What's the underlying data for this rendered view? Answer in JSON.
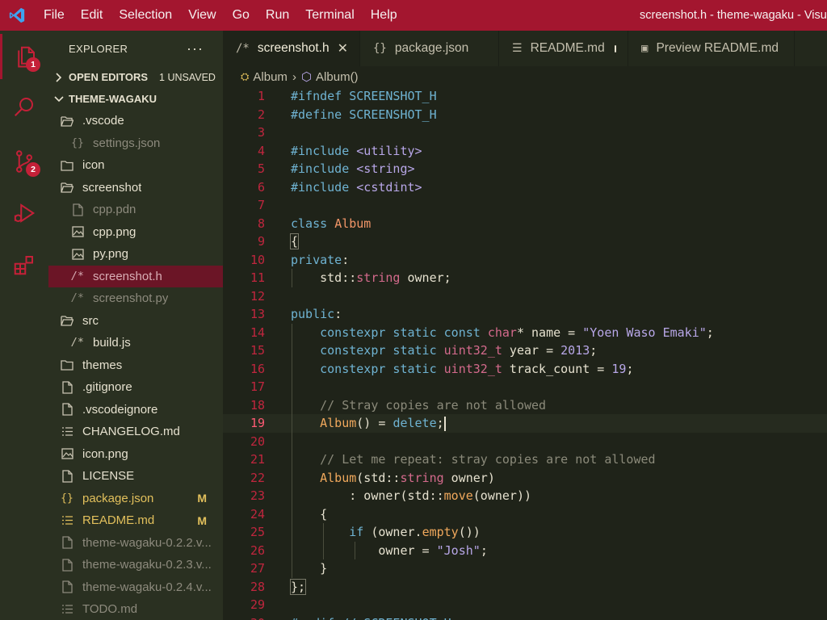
{
  "titlebar": {
    "menu": [
      "File",
      "Edit",
      "Selection",
      "View",
      "Go",
      "Run",
      "Terminal",
      "Help"
    ],
    "window_title": "screenshot.h - theme-wagaku - Visu"
  },
  "activity": {
    "explorer_badge": "1",
    "scm_badge": "2"
  },
  "sidebar": {
    "title": "EXPLORER",
    "more": "···",
    "open_editors": "OPEN EDITORS",
    "unsaved": "1 UNSAVED",
    "project": "THEME-WAGAKU",
    "items": [
      {
        "label": ".vscode",
        "icon": "folder-open",
        "indent": 15,
        "state": ""
      },
      {
        "label": "settings.json",
        "icon": "braces",
        "indent": 28,
        "state": "dim"
      },
      {
        "label": "icon",
        "icon": "folder",
        "indent": 15,
        "state": ""
      },
      {
        "label": "screenshot",
        "icon": "folder-open",
        "indent": 15,
        "state": ""
      },
      {
        "label": "cpp.pdn",
        "icon": "file",
        "indent": 28,
        "state": "dim"
      },
      {
        "label": "cpp.png",
        "icon": "image",
        "indent": 28,
        "state": ""
      },
      {
        "label": "py.png",
        "icon": "image",
        "indent": 28,
        "state": ""
      },
      {
        "label": "screenshot.h",
        "icon": "comment",
        "indent": 28,
        "state": "selected"
      },
      {
        "label": "screenshot.py",
        "icon": "comment",
        "indent": 28,
        "state": "dim"
      },
      {
        "label": "src",
        "icon": "folder-open",
        "indent": 15,
        "state": ""
      },
      {
        "label": "build.js",
        "icon": "comment",
        "indent": 28,
        "state": ""
      },
      {
        "label": "themes",
        "icon": "folder",
        "indent": 15,
        "state": ""
      },
      {
        "label": ".gitignore",
        "icon": "file",
        "indent": 15,
        "state": ""
      },
      {
        "label": ".vscodeignore",
        "icon": "file",
        "indent": 15,
        "state": ""
      },
      {
        "label": "CHANGELOG.md",
        "icon": "lines",
        "indent": 15,
        "state": ""
      },
      {
        "label": "icon.png",
        "icon": "image",
        "indent": 15,
        "state": ""
      },
      {
        "label": "LICENSE",
        "icon": "file",
        "indent": 15,
        "state": ""
      },
      {
        "label": "package.json",
        "icon": "braces",
        "indent": 15,
        "state": "mod",
        "mark": "M"
      },
      {
        "label": "README.md",
        "icon": "lines",
        "indent": 15,
        "state": "mod",
        "mark": "M"
      },
      {
        "label": "theme-wagaku-0.2.2.v...",
        "icon": "file",
        "indent": 15,
        "state": "dim"
      },
      {
        "label": "theme-wagaku-0.2.3.v...",
        "icon": "file",
        "indent": 15,
        "state": "dim"
      },
      {
        "label": "theme-wagaku-0.2.4.v...",
        "icon": "file",
        "indent": 15,
        "state": "dim"
      },
      {
        "label": "TODO.md",
        "icon": "lines",
        "indent": 15,
        "state": "dim"
      }
    ]
  },
  "tabs": [
    {
      "icon": "/*",
      "label": "screenshot.h",
      "active": true,
      "close": "✕"
    },
    {
      "icon": "{}",
      "label": "package.json",
      "active": false
    },
    {
      "icon": "☰",
      "label": "README.md",
      "active": false,
      "dirty": true
    },
    {
      "icon": "▣",
      "label": "Preview README.md",
      "active": false
    }
  ],
  "breadcrumb": {
    "first": "Album",
    "second": "Album()"
  },
  "editor": {
    "current_line": 19,
    "lines": [
      [
        [
          "pp",
          "#ifndef SCREENSHOT_H"
        ]
      ],
      [
        [
          "pp",
          "#define SCREENSHOT_H"
        ]
      ],
      [],
      [
        [
          "pp",
          "#include "
        ],
        [
          "str",
          "<utility>"
        ]
      ],
      [
        [
          "pp",
          "#include "
        ],
        [
          "str",
          "<string>"
        ]
      ],
      [
        [
          "pp",
          "#include "
        ],
        [
          "str",
          "<cstdint>"
        ]
      ],
      [],
      [
        [
          "kw",
          "class "
        ],
        [
          "cls",
          "Album"
        ]
      ],
      [
        [
          "tx2",
          "{"
        ]
      ],
      [
        [
          "kw",
          "private"
        ],
        [
          "tx2",
          ":"
        ]
      ],
      [
        [
          "tx2",
          "    std::"
        ],
        [
          "ty",
          "string"
        ],
        [
          "tx2",
          " owner;"
        ]
      ],
      [],
      [
        [
          "kw",
          "public"
        ],
        [
          "tx2",
          ":"
        ]
      ],
      [
        [
          "tx2",
          "    "
        ],
        [
          "kw",
          "constexpr static const "
        ],
        [
          "ty",
          "char"
        ],
        [
          "tx2",
          "* name = "
        ],
        [
          "str",
          "\"Yoen Waso Emaki\""
        ],
        [
          "tx2",
          ";"
        ]
      ],
      [
        [
          "tx2",
          "    "
        ],
        [
          "kw",
          "constexpr static "
        ],
        [
          "ty",
          "uint32_t"
        ],
        [
          "tx2",
          " year = "
        ],
        [
          "num",
          "2013"
        ],
        [
          "tx2",
          ";"
        ]
      ],
      [
        [
          "tx2",
          "    "
        ],
        [
          "kw",
          "constexpr static "
        ],
        [
          "ty",
          "uint32_t"
        ],
        [
          "tx2",
          " track_count = "
        ],
        [
          "num",
          "19"
        ],
        [
          "tx2",
          ";"
        ]
      ],
      [],
      [
        [
          "cm",
          "    // Stray copies are not allowed"
        ]
      ],
      [
        [
          "tx2",
          "    "
        ],
        [
          "fn",
          "Album"
        ],
        [
          "tx2",
          "() = "
        ],
        [
          "kw",
          "delete"
        ],
        [
          "tx2",
          ";"
        ]
      ],
      [],
      [
        [
          "cm",
          "    // Let me repeat: stray copies are not allowed"
        ]
      ],
      [
        [
          "tx2",
          "    "
        ],
        [
          "fn",
          "Album"
        ],
        [
          "tx2",
          "(std::"
        ],
        [
          "ty",
          "string"
        ],
        [
          "tx2",
          " owner)"
        ]
      ],
      [
        [
          "tx2",
          "        : owner(std::"
        ],
        [
          "fn",
          "move"
        ],
        [
          "tx2",
          "(owner))"
        ]
      ],
      [
        [
          "tx2",
          "    {"
        ]
      ],
      [
        [
          "tx2",
          "        "
        ],
        [
          "kw",
          "if"
        ],
        [
          "tx2",
          " (owner."
        ],
        [
          "fn",
          "empty"
        ],
        [
          "tx2",
          "())"
        ]
      ],
      [
        [
          "tx2",
          "            owner = "
        ],
        [
          "str",
          "\"Josh\""
        ],
        [
          "tx2",
          ";"
        ]
      ],
      [
        [
          "tx2",
          "    }"
        ]
      ],
      [
        [
          "tx2",
          "};"
        ]
      ],
      [],
      [
        [
          "pp",
          "#endif // SCREENSHOT_H"
        ]
      ]
    ]
  }
}
